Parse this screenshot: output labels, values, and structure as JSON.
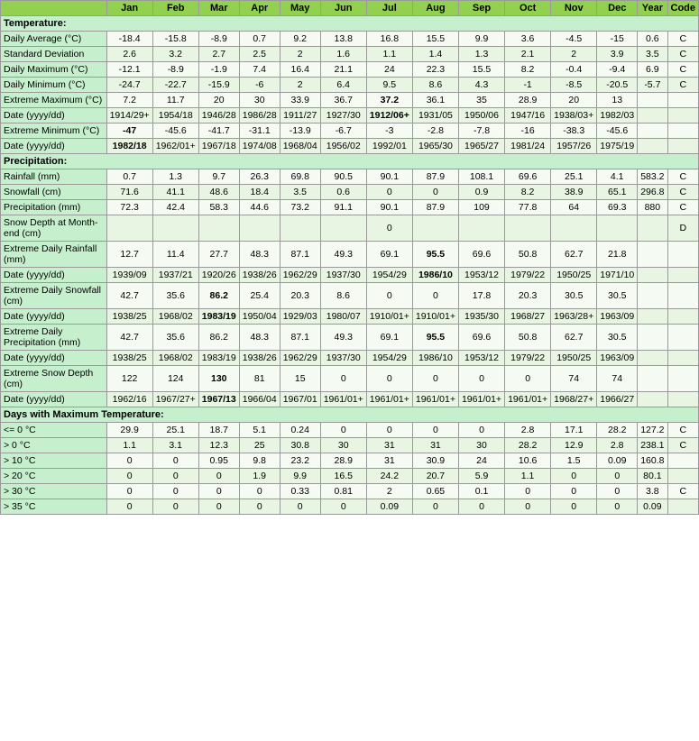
{
  "headers": [
    "",
    "Jan",
    "Feb",
    "Mar",
    "Apr",
    "May",
    "Jun",
    "Jul",
    "Aug",
    "Sep",
    "Oct",
    "Nov",
    "Dec",
    "Year",
    "Code"
  ],
  "sections": [
    {
      "title": "Temperature:",
      "rows": [
        {
          "label": "Daily Average (°C)",
          "values": [
            "-18.4",
            "-15.8",
            "-8.9",
            "0.7",
            "9.2",
            "13.8",
            "16.8",
            "15.5",
            "9.9",
            "3.6",
            "-4.5",
            "-15",
            "0.6",
            "C"
          ],
          "bold": []
        },
        {
          "label": "Standard Deviation",
          "values": [
            "2.6",
            "3.2",
            "2.7",
            "2.5",
            "2",
            "1.6",
            "1.1",
            "1.4",
            "1.3",
            "2.1",
            "2",
            "3.9",
            "3.5",
            "C"
          ],
          "bold": []
        },
        {
          "label": "Daily Maximum (°C)",
          "values": [
            "-12.1",
            "-8.9",
            "-1.9",
            "7.4",
            "16.4",
            "21.1",
            "24",
            "22.3",
            "15.5",
            "8.2",
            "-0.4",
            "-9.4",
            "6.9",
            "C"
          ],
          "bold": []
        },
        {
          "label": "Daily Minimum (°C)",
          "values": [
            "-24.7",
            "-22.7",
            "-15.9",
            "-6",
            "2",
            "6.4",
            "9.5",
            "8.6",
            "4.3",
            "-1",
            "-8.5",
            "-20.5",
            "-5.7",
            "C"
          ],
          "bold": []
        },
        {
          "label": "Extreme Maximum (°C)",
          "values": [
            "7.2",
            "11.7",
            "20",
            "30",
            "33.9",
            "36.7",
            "37.2",
            "36.1",
            "35",
            "28.9",
            "20",
            "13",
            "",
            ""
          ],
          "bold": [
            "37.2"
          ]
        },
        {
          "label": "Date (yyyy/dd)",
          "values": [
            "1914/29+",
            "1954/18",
            "1946/28",
            "1986/28",
            "1911/27",
            "1927/30",
            "1912/06+",
            "1931/05",
            "1950/06",
            "1947/16",
            "1938/03+",
            "1982/03",
            "",
            ""
          ],
          "bold": [
            "1912/06+"
          ]
        },
        {
          "label": "Extreme Minimum (°C)",
          "values": [
            "-47",
            "-45.6",
            "-41.7",
            "-31.1",
            "-13.9",
            "-6.7",
            "-3",
            "-2.8",
            "-7.8",
            "-16",
            "-38.3",
            "-45.6",
            "",
            ""
          ],
          "bold": [
            "-47"
          ]
        },
        {
          "label": "Date (yyyy/dd)",
          "values": [
            "1982/18",
            "1962/01+",
            "1967/18",
            "1974/08",
            "1968/04",
            "1956/02",
            "1992/01",
            "1965/30",
            "1965/27",
            "1981/24",
            "1957/26",
            "1975/19",
            "",
            ""
          ],
          "bold": [
            "1982/18"
          ]
        }
      ]
    },
    {
      "title": "Precipitation:",
      "rows": [
        {
          "label": "Rainfall (mm)",
          "values": [
            "0.7",
            "1.3",
            "9.7",
            "26.3",
            "69.8",
            "90.5",
            "90.1",
            "87.9",
            "108.1",
            "69.6",
            "25.1",
            "4.1",
            "583.2",
            "C"
          ],
          "bold": []
        },
        {
          "label": "Snowfall (cm)",
          "values": [
            "71.6",
            "41.1",
            "48.6",
            "18.4",
            "3.5",
            "0.6",
            "0",
            "0",
            "0.9",
            "8.2",
            "38.9",
            "65.1",
            "296.8",
            "C"
          ],
          "bold": []
        },
        {
          "label": "Precipitation (mm)",
          "values": [
            "72.3",
            "42.4",
            "58.3",
            "44.6",
            "73.2",
            "91.1",
            "90.1",
            "87.9",
            "109",
            "77.8",
            "64",
            "69.3",
            "880",
            "C"
          ],
          "bold": []
        },
        {
          "label": "Snow Depth at Month-end (cm)",
          "values": [
            "",
            "",
            "",
            "",
            "",
            "",
            "0",
            "",
            "",
            "",
            "",
            "",
            "",
            "D"
          ],
          "bold": []
        }
      ]
    },
    {
      "title": "",
      "rows": [
        {
          "label": "Extreme Daily Rainfall (mm)",
          "values": [
            "12.7",
            "11.4",
            "27.7",
            "48.3",
            "87.1",
            "49.3",
            "69.1",
            "95.5",
            "69.6",
            "50.8",
            "62.7",
            "21.8",
            "",
            ""
          ],
          "bold": [
            "95.5"
          ]
        },
        {
          "label": "Date (yyyy/dd)",
          "values": [
            "1939/09",
            "1937/21",
            "1920/26",
            "1938/26",
            "1962/29",
            "1937/30",
            "1954/29",
            "1986/10",
            "1953/12",
            "1979/22",
            "1950/25",
            "1971/10",
            "",
            ""
          ],
          "bold": [
            "1986/10"
          ]
        },
        {
          "label": "Extreme Daily Snowfall (cm)",
          "values": [
            "42.7",
            "35.6",
            "86.2",
            "25.4",
            "20.3",
            "8.6",
            "0",
            "0",
            "17.8",
            "20.3",
            "30.5",
            "30.5",
            "",
            ""
          ],
          "bold": [
            "86.2"
          ]
        },
        {
          "label": "Date (yyyy/dd)",
          "values": [
            "1938/25",
            "1968/02",
            "1983/19",
            "1950/04",
            "1929/03",
            "1980/07",
            "1910/01+",
            "1910/01+",
            "1935/30",
            "1968/27",
            "1963/28+",
            "1963/09",
            "",
            ""
          ],
          "bold": [
            "1983/19"
          ]
        },
        {
          "label": "Extreme Daily Precipitation (mm)",
          "values": [
            "42.7",
            "35.6",
            "86.2",
            "48.3",
            "87.1",
            "49.3",
            "69.1",
            "95.5",
            "69.6",
            "50.8",
            "62.7",
            "30.5",
            "",
            ""
          ],
          "bold": [
            "95.5"
          ]
        },
        {
          "label": "Date (yyyy/dd)",
          "values": [
            "1938/25",
            "1968/02",
            "1983/19",
            "1938/26",
            "1962/29",
            "1937/30",
            "1954/29",
            "1986/10",
            "1953/12",
            "1979/22",
            "1950/25",
            "1963/09",
            "",
            ""
          ],
          "bold": []
        },
        {
          "label": "Extreme Snow Depth (cm)",
          "values": [
            "122",
            "124",
            "130",
            "81",
            "15",
            "0",
            "0",
            "0",
            "0",
            "0",
            "74",
            "74",
            "",
            ""
          ],
          "bold": [
            "130"
          ]
        },
        {
          "label": "Date (yyyy/dd)",
          "values": [
            "1962/16",
            "1967/27+",
            "1967/13",
            "1966/04",
            "1967/01",
            "1961/01+",
            "1961/01+",
            "1961/01+",
            "1961/01+",
            "1961/01+",
            "1968/27+",
            "1966/27",
            "",
            ""
          ],
          "bold": [
            "1967/13"
          ]
        }
      ]
    },
    {
      "title": "Days with Maximum Temperature:",
      "rows": [
        {
          "label": "<= 0 °C",
          "values": [
            "29.9",
            "25.1",
            "18.7",
            "5.1",
            "0.24",
            "0",
            "0",
            "0",
            "0",
            "2.8",
            "17.1",
            "28.2",
            "127.2",
            "C"
          ],
          "bold": []
        },
        {
          "label": "> 0 °C",
          "values": [
            "1.1",
            "3.1",
            "12.3",
            "25",
            "30.8",
            "30",
            "31",
            "31",
            "30",
            "28.2",
            "12.9",
            "2.8",
            "238.1",
            "C"
          ],
          "bold": []
        },
        {
          "label": "> 10 °C",
          "values": [
            "0",
            "0",
            "0.95",
            "9.8",
            "23.2",
            "28.9",
            "31",
            "30.9",
            "24",
            "10.6",
            "1.5",
            "0.09",
            "160.8",
            ""
          ],
          "bold": []
        },
        {
          "label": "> 20 °C",
          "values": [
            "0",
            "0",
            "0",
            "1.9",
            "9.9",
            "16.5",
            "24.2",
            "20.7",
            "5.9",
            "1.1",
            "0",
            "0",
            "80.1",
            ""
          ],
          "bold": []
        },
        {
          "label": "> 30 °C",
          "values": [
            "0",
            "0",
            "0",
            "0",
            "0.33",
            "0.81",
            "2",
            "0.65",
            "0.1",
            "0",
            "0",
            "0",
            "3.8",
            "C"
          ],
          "bold": []
        },
        {
          "label": "> 35 °C",
          "values": [
            "0",
            "0",
            "0",
            "0",
            "0",
            "0",
            "0.09",
            "0",
            "0",
            "0",
            "0",
            "0",
            "0.09",
            ""
          ],
          "bold": []
        }
      ]
    }
  ]
}
